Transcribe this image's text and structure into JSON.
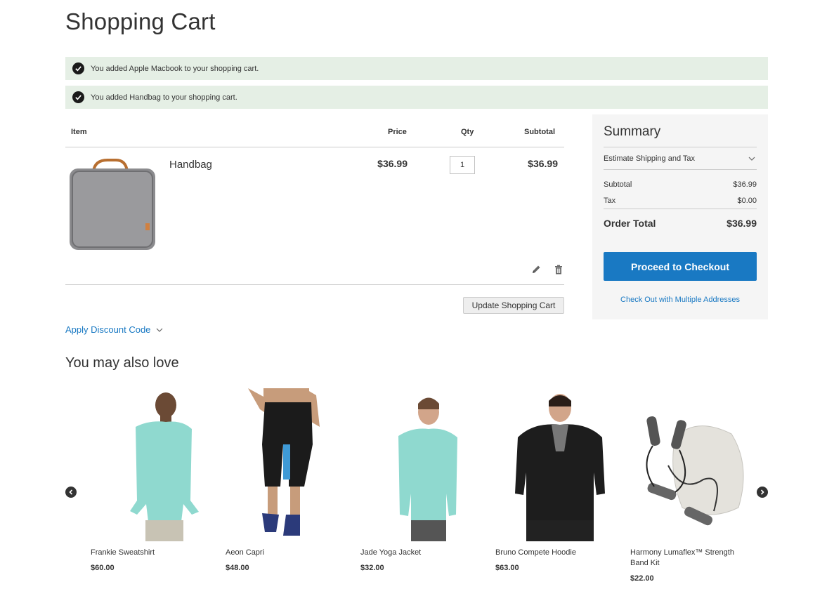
{
  "page": {
    "title": "Shopping Cart"
  },
  "messages": [
    {
      "text": "You added Apple Macbook to your shopping cart."
    },
    {
      "text": "You added Handbag to your shopping cart."
    }
  ],
  "cart": {
    "headers": {
      "item": "Item",
      "price": "Price",
      "qty": "Qty",
      "subtotal": "Subtotal"
    },
    "items": [
      {
        "name": "Handbag",
        "price": "$36.99",
        "qty": "1",
        "subtotal": "$36.99"
      }
    ],
    "update_label": "Update Shopping Cart",
    "discount_label": "Apply Discount Code"
  },
  "summary": {
    "title": "Summary",
    "shipping_label": "Estimate Shipping and Tax",
    "subtotal_label": "Subtotal",
    "subtotal_value": "$36.99",
    "tax_label": "Tax",
    "tax_value": "$0.00",
    "total_label": "Order Total",
    "total_value": "$36.99",
    "checkout_label": "Proceed to Checkout",
    "multi_label": "Check Out with Multiple Addresses"
  },
  "related": {
    "title": "You may also love",
    "items": [
      {
        "name": "Frankie Sweatshirt",
        "price": "$60.00",
        "icon": "sweatshirt-image"
      },
      {
        "name": "Aeon Capri",
        "price": "$48.00",
        "icon": "capri-image"
      },
      {
        "name": "Jade Yoga Jacket",
        "price": "$32.00",
        "icon": "jacket-image"
      },
      {
        "name": "Bruno Compete Hoodie",
        "price": "$63.00",
        "icon": "hoodie-image"
      },
      {
        "name": "Harmony Lumaflex™ Strength Band Kit",
        "price": "$22.00",
        "icon": "band-kit-image"
      }
    ]
  },
  "colors": {
    "accent": "#1979c3",
    "success_bg": "#e5efe5",
    "summary_bg": "#f5f5f5"
  }
}
